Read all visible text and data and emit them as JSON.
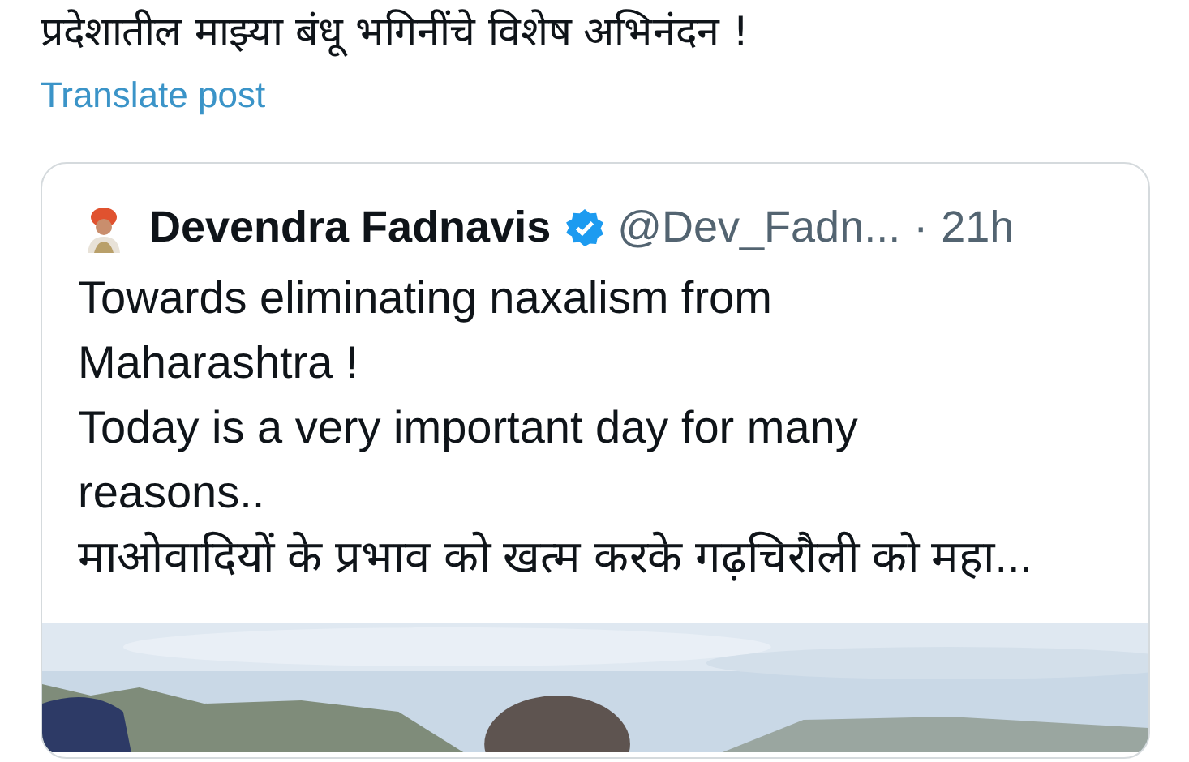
{
  "post": {
    "text": "प्रदेशातील माझ्या बंधू भगिनींचे विशेष अभिनंदन !",
    "translate_link": "Translate post"
  },
  "quoted_post": {
    "author": "Devendra Fadnavis",
    "verified": true,
    "handle": "@Dev_Fadn...",
    "separator": "·",
    "time": "21h",
    "paragraphs": [
      "Towards eliminating naxalism from Maharashtra !",
      "Today is a very important day for many reasons..",
      "माओवादियों के प्रभाव को खत्म करके गढ़चिरौली को महा..."
    ]
  }
}
